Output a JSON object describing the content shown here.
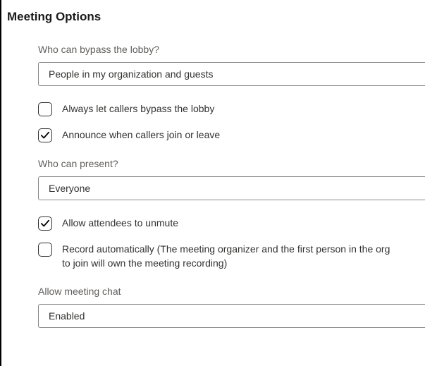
{
  "title": "Meeting Options",
  "lobby": {
    "label": "Who can bypass the lobby?",
    "selected": "People in my organization and guests"
  },
  "options": {
    "bypass_callers": {
      "label": "Always let callers bypass the lobby",
      "checked": false
    },
    "announce": {
      "label": "Announce when callers join or leave",
      "checked": true
    },
    "unmute": {
      "label": "Allow attendees to unmute",
      "checked": true
    },
    "record": {
      "label": "Record automatically (The meeting organizer and the first person in the org to join will own the meeting recording)",
      "checked": false
    }
  },
  "present": {
    "label": "Who can present?",
    "selected": "Everyone"
  },
  "chat": {
    "label": "Allow meeting chat",
    "selected": "Enabled"
  }
}
